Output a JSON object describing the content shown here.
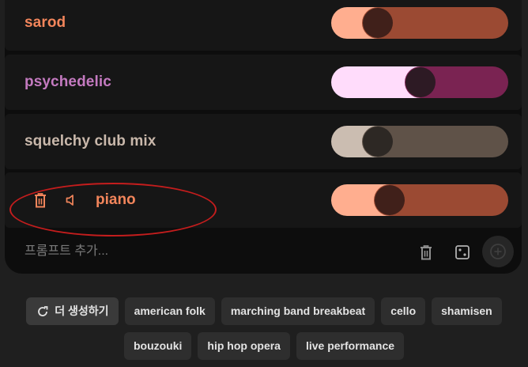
{
  "prompts": [
    {
      "label": "sarod",
      "label_color": "#f2855b",
      "fill_color": "#ffae8f",
      "rest_color": "#9b4a33",
      "thumb_color": "#40201a",
      "level": 0.21
    },
    {
      "label": "psychedelic",
      "label_color": "#c47ac0",
      "fill_color": "#ffdcfb",
      "rest_color": "#7a2352",
      "thumb_color": "#2d1a24",
      "level": 0.5
    },
    {
      "label": "squelchy club mix",
      "label_color": "#c9b8ab",
      "fill_color": "#cbbdb1",
      "rest_color": "#5f5248",
      "thumb_color": "#2d2824",
      "level": 0.21
    },
    {
      "label": "piano",
      "label_color": "#f2855b",
      "fill_color": "#ffae8f",
      "rest_color": "#9b4a33",
      "thumb_color": "#40201a",
      "level": 0.29
    }
  ],
  "piano_icons": {
    "delete": "trash-icon",
    "mute": "speaker-icon"
  },
  "add_prompt": {
    "placeholder": "프롬프트 추가...",
    "icons": [
      "trash-icon",
      "dice-icon",
      "add-circle-icon"
    ]
  },
  "suggestions": {
    "regenerate_label": "더 생성하기",
    "row1": [
      "american folk",
      "marching band breakbeat",
      "cello",
      "shamisen"
    ],
    "row2": [
      "bouzouki",
      "hip hop opera",
      "live performance"
    ]
  },
  "colors": {
    "background": "#1f1f1f",
    "panel": "#0d0d0d",
    "row": "#161616",
    "chip": "#2e2e2e",
    "highlight": "#c41d1d"
  }
}
